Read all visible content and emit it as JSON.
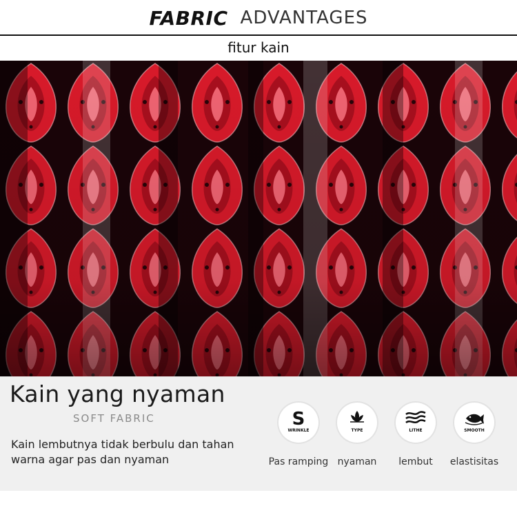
{
  "header": {
    "title_bold": "FABRIC",
    "title_light": "ADVANTAGES",
    "subtitle": "fitur kain"
  },
  "photo": {
    "description_icon": "red-black-batik-fabric-photo",
    "colors": {
      "red": "#d81a2a",
      "dark": "#1a0408",
      "pale": "#f3b8bd"
    }
  },
  "info": {
    "heading": "Kain yang nyaman",
    "sub": "SOFT FABRIC",
    "desc": "Kain lembutnya tidak berbulu dan tahan warna agar pas dan nyaman",
    "features": [
      {
        "icon": "wrinkle-s-icon",
        "badge": "WRINKLE",
        "label": "Pas ramping"
      },
      {
        "icon": "lotus-icon",
        "badge": "TYPE",
        "label": "nyaman"
      },
      {
        "icon": "waves-icon",
        "badge": "LITHE",
        "label": "lembut"
      },
      {
        "icon": "fish-icon",
        "badge": "SMOOTH",
        "label": "elastisitas"
      }
    ]
  }
}
